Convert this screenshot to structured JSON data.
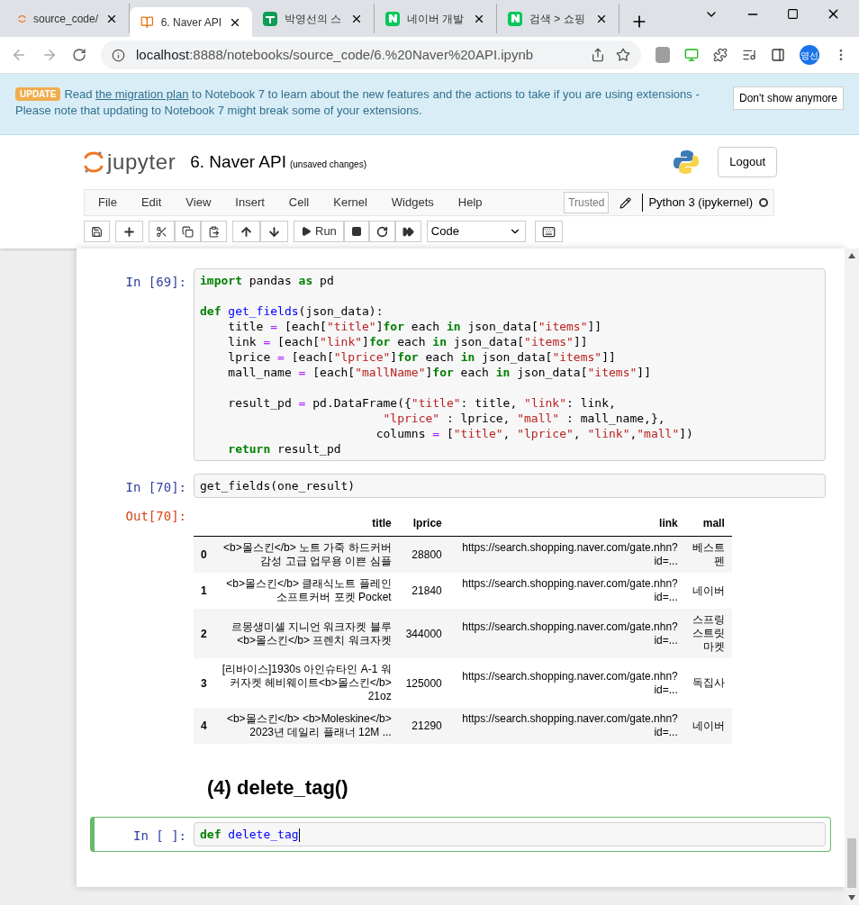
{
  "browser": {
    "tabs": [
      {
        "label": "source_code/",
        "selected": false,
        "kind": "jupyter"
      },
      {
        "label": "6. Naver API",
        "selected": true,
        "kind": "book"
      },
      {
        "label": "박영선의 스",
        "selected": false,
        "kind": "sheet"
      },
      {
        "label": "네이버 개발",
        "selected": false,
        "kind": "naver"
      },
      {
        "label": "검색 > 쇼핑",
        "selected": false,
        "kind": "naver"
      }
    ],
    "url_host": "localhost",
    "url_rest": ":8888/notebooks/source_code/6.%20Naver%20API.ipynb",
    "profile": "영선"
  },
  "banner": {
    "badge": "UPDATE",
    "before": "Read ",
    "link": "the migration plan",
    "after": " to Notebook 7 to learn about the new features and the actions to take if you are using extensions - Please note that updating to Notebook 7 might break some of your extensions.",
    "button": "Don't show anymore"
  },
  "header": {
    "logo": "jupyter",
    "title": "6. Naver API",
    "status": "(unsaved changes)",
    "logout": "Logout"
  },
  "menu": {
    "items": [
      "File",
      "Edit",
      "View",
      "Insert",
      "Cell",
      "Kernel",
      "Widgets",
      "Help"
    ],
    "trusted": "Trusted",
    "kernel": "Python 3 (ipykernel)"
  },
  "toolbar": {
    "run": "Run",
    "cell_type": "Code"
  },
  "cells": [
    {
      "kind": "code",
      "prompt": "In [69]:",
      "selected": false,
      "blocks": [
        [
          [
            {
              "kind": "kw",
              "text": "import"
            },
            {
              "kind": "p",
              "text": " pandas "
            },
            {
              "kind": "kw",
              "text": "as"
            },
            {
              "kind": "p",
              "text": " pd"
            }
          ]
        ],
        [
          [
            {
              "kind": "kw",
              "text": "def"
            },
            {
              "kind": "fn",
              "text": " get_fields"
            },
            {
              "kind": "p",
              "text": "(json_data):"
            }
          ],
          [
            {
              "kind": "p",
              "text": "    title "
            },
            {
              "kind": "op",
              "text": "="
            },
            {
              "kind": "p",
              "text": " [each["
            },
            {
              "kind": "str",
              "text": "\"title\""
            },
            {
              "kind": "p",
              "text": "]"
            },
            {
              "kind": "kw",
              "text": "for"
            },
            {
              "kind": "p",
              "text": " each "
            },
            {
              "kind": "kw",
              "text": "in"
            },
            {
              "kind": "p",
              "text": " json_data["
            },
            {
              "kind": "str",
              "text": "\"items\""
            },
            {
              "kind": "p",
              "text": "]]"
            }
          ],
          [
            {
              "kind": "p",
              "text": "    link "
            },
            {
              "kind": "op",
              "text": "="
            },
            {
              "kind": "p",
              "text": " [each["
            },
            {
              "kind": "str",
              "text": "\"link\""
            },
            {
              "kind": "p",
              "text": "]"
            },
            {
              "kind": "kw",
              "text": "for"
            },
            {
              "kind": "p",
              "text": " each "
            },
            {
              "kind": "kw",
              "text": "in"
            },
            {
              "kind": "p",
              "text": " json_data["
            },
            {
              "kind": "str",
              "text": "\"items\""
            },
            {
              "kind": "p",
              "text": "]]"
            }
          ],
          [
            {
              "kind": "p",
              "text": "    lprice "
            },
            {
              "kind": "op",
              "text": "="
            },
            {
              "kind": "p",
              "text": " [each["
            },
            {
              "kind": "str",
              "text": "\"lprice\""
            },
            {
              "kind": "p",
              "text": "]"
            },
            {
              "kind": "kw",
              "text": "for"
            },
            {
              "kind": "p",
              "text": " each "
            },
            {
              "kind": "kw",
              "text": "in"
            },
            {
              "kind": "p",
              "text": " json_data["
            },
            {
              "kind": "str",
              "text": "\"items\""
            },
            {
              "kind": "p",
              "text": "]]"
            }
          ],
          [
            {
              "kind": "p",
              "text": "    mall_name "
            },
            {
              "kind": "op",
              "text": "="
            },
            {
              "kind": "p",
              "text": " [each["
            },
            {
              "kind": "str",
              "text": "\"mallName\""
            },
            {
              "kind": "p",
              "text": "]"
            },
            {
              "kind": "kw",
              "text": "for"
            },
            {
              "kind": "p",
              "text": " each "
            },
            {
              "kind": "kw",
              "text": "in"
            },
            {
              "kind": "p",
              "text": " json_data["
            },
            {
              "kind": "str",
              "text": "\"items\""
            },
            {
              "kind": "p",
              "text": "]]"
            }
          ]
        ],
        [
          [
            {
              "kind": "p",
              "text": "    result_pd "
            },
            {
              "kind": "op",
              "text": "="
            },
            {
              "kind": "p",
              "text": " pd.DataFrame({"
            },
            {
              "kind": "str",
              "text": "\"title\""
            },
            {
              "kind": "p",
              "text": ": title, "
            },
            {
              "kind": "str",
              "text": "\"link\""
            },
            {
              "kind": "p",
              "text": ": link,"
            }
          ],
          [
            {
              "kind": "str",
              "text": "                          \"lprice\""
            },
            {
              "kind": "p",
              "text": " : lprice, "
            },
            {
              "kind": "str",
              "text": "\"mall\""
            },
            {
              "kind": "p",
              "text": " : mall_name,},"
            }
          ],
          [
            {
              "kind": "p",
              "text": "                         columns "
            },
            {
              "kind": "op",
              "text": "="
            },
            {
              "kind": "p",
              "text": " ["
            },
            {
              "kind": "str",
              "text": "\"title\""
            },
            {
              "kind": "p",
              "text": ", "
            },
            {
              "kind": "str",
              "text": "\"lprice\""
            },
            {
              "kind": "p",
              "text": ", "
            },
            {
              "kind": "str",
              "text": "\"link\""
            },
            {
              "kind": "p",
              "text": ","
            },
            {
              "kind": "str",
              "text": "\"mall\""
            },
            {
              "kind": "p",
              "text": "])"
            }
          ],
          [
            {
              "kind": "kw",
              "text": "    return"
            },
            {
              "kind": "p",
              "text": " result_pd"
            }
          ]
        ]
      ]
    },
    {
      "kind": "code",
      "prompt": "In [70]:",
      "selected": false,
      "blocks": [
        [
          [
            {
              "kind": "p",
              "text": "get_fields(one_result)"
            }
          ]
        ]
      ]
    },
    {
      "kind": "table",
      "prompt": "Out[70]:",
      "columns": [
        "title",
        "lprice",
        "link",
        "mall"
      ],
      "rows": [
        {
          "index": "0",
          "title": "<b>몰스킨</b> 노트 가죽 하드커버 감성 고급 업무용 이쁜 심플",
          "lprice": "28800",
          "link": "https://search.shopping.naver.com/gate.nhn?id=...",
          "mall": "베스트펜"
        },
        {
          "index": "1",
          "title": "<b>몰스킨</b> 클래식노트 플레인 소프트커버 포켓 Pocket",
          "lprice": "21840",
          "link": "https://search.shopping.naver.com/gate.nhn?id=...",
          "mall": "네이버"
        },
        {
          "index": "2",
          "title": "르몽생미셸 지니언 워크자켓 블루 <b>몰스킨</b> 프렌치 워크자켓",
          "lprice": "344000",
          "link": "https://search.shopping.naver.com/gate.nhn?id=...",
          "mall": "스프링스트릿마켓"
        },
        {
          "index": "3",
          "title": "[리바이스]1930s 아인슈타인 A-1 워커자켓 헤비웨이트<b>몰스킨</b> 21oz",
          "lprice": "125000",
          "link": "https://search.shopping.naver.com/gate.nhn?id=...",
          "mall": "독집사"
        },
        {
          "index": "4",
          "title": "<b>몰스킨</b> <b>Moleskine</b> 2023년 데일리 플래너 12M ...",
          "lprice": "21290",
          "link": "https://search.shopping.naver.com/gate.nhn?id=...",
          "mall": "네이버"
        }
      ]
    },
    {
      "kind": "heading",
      "text": "(4) delete_tag()"
    },
    {
      "kind": "code",
      "prompt": "In [ ]:",
      "selected": true,
      "blocks": [
        [
          [
            {
              "kind": "kw",
              "text": "def"
            },
            {
              "kind": "fn",
              "text": " delete_tag"
            }
          ]
        ]
      ]
    }
  ]
}
